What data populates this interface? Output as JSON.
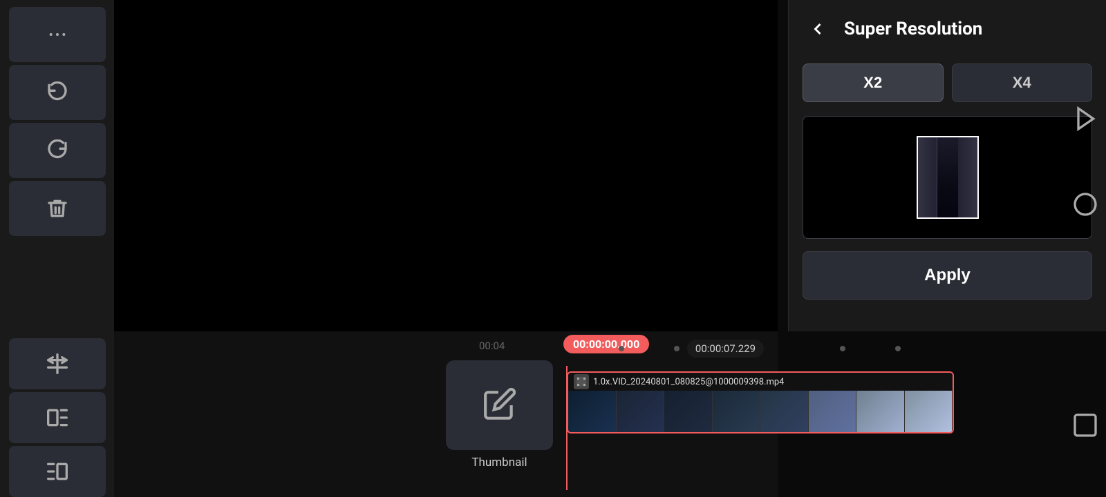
{
  "toolbar": {
    "more_label": "···",
    "undo_label": "↺",
    "redo_label": "↻",
    "delete_label": "🗑",
    "split_label": "⊞",
    "trim_label": "◧",
    "export_label": "→◧"
  },
  "timeline": {
    "current_time": "00:00:00.000",
    "mid_time": "00:04",
    "end_time": "00:00:07.229",
    "clip_name": "1.0x.VID_20240801_080825@1000009398.mp4"
  },
  "thumbnail": {
    "label": "Thumbnail"
  },
  "super_resolution": {
    "title": "Super Resolution",
    "back_label": "‹",
    "x2_label": "X2",
    "x4_label": "X4",
    "apply_label": "Apply"
  },
  "colors": {
    "accent": "#f25c5c",
    "panel_bg": "#1a1a1a",
    "btn_bg": "#2a2d35",
    "active_bg": "#3a3d45"
  }
}
